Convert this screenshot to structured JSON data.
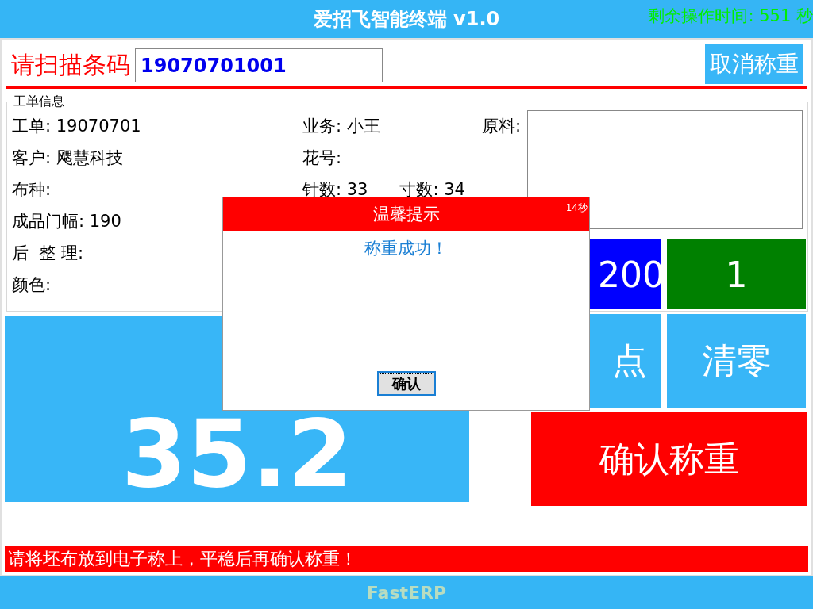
{
  "header": {
    "title": "爱招飞智能终端 v1.0",
    "timer": "剩余操作时间: 551 秒"
  },
  "scan": {
    "label": "请扫描条码",
    "value": "19070701001",
    "cancel_button": "取消称重"
  },
  "work_order": {
    "legend": "工单信息",
    "left": [
      "工单: 19070701",
      "客户: 飔慧科技",
      "布种:",
      "成品门幅: 190",
      "后  整 理:",
      "颜色:"
    ],
    "middle": [
      [
        "业务: 小王"
      ],
      [
        "花号:"
      ],
      [
        "针数: 33",
        "寸数: 34"
      ]
    ],
    "material_label": "原料:"
  },
  "weight": "35.2",
  "keys": [
    {
      "label": "200",
      "color": "#0000ff"
    },
    {
      "label": "1",
      "color": "#008000"
    },
    {
      "label": "点",
      "color": "#38b6f7"
    },
    {
      "label": "清零",
      "color": "#38b6f7"
    }
  ],
  "confirm_button": "确认称重",
  "status": "请将坯布放到电子称上，平稳后再确认称重！",
  "footer": "FastERP",
  "dialog": {
    "title": "温馨提示",
    "countdown": "14秒",
    "message": "称重成功！",
    "button": "确认"
  }
}
